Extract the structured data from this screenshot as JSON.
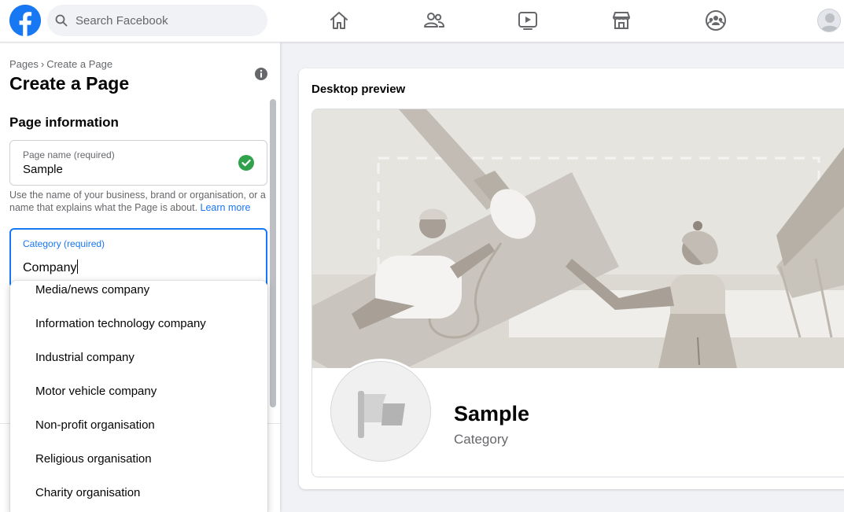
{
  "topbar": {
    "search_placeholder": "Search Facebook",
    "nav": [
      "home-icon",
      "friends-icon",
      "watch-icon",
      "marketplace-icon",
      "groups-icon"
    ],
    "brand_color": "#1877f2"
  },
  "left": {
    "breadcrumb": {
      "parent": "Pages",
      "separator": "›",
      "current": "Create a Page"
    },
    "title": "Create a Page",
    "section_title": "Page information",
    "page_name_field": {
      "label": "Page name (required)",
      "value": "Sample"
    },
    "hint": {
      "text": "Use the name of your business, brand or organisation, or a name that explains what the Page is about.",
      "link": "Learn more"
    },
    "category_field": {
      "label": "Category (required)",
      "value": "Company"
    },
    "dropdown_options": [
      "Media/news company",
      "Information technology company",
      "Industrial company",
      "Motor vehicle company",
      "Non-profit organisation",
      "Religious organisation",
      "Charity organisation"
    ]
  },
  "preview": {
    "title": "Desktop preview",
    "page_name": "Sample",
    "category": "Category"
  }
}
